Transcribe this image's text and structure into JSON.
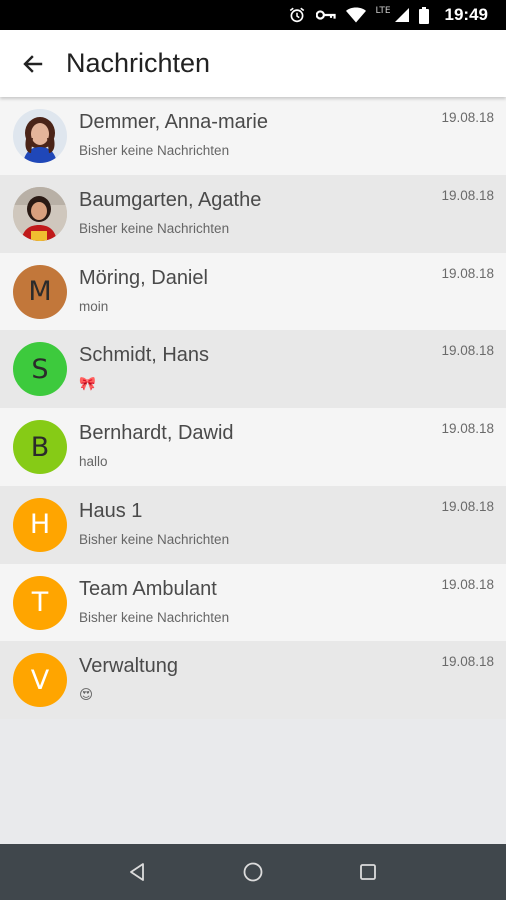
{
  "status_bar": {
    "network": "LTE",
    "time": "19:49",
    "icons": [
      "alarm-icon",
      "vpn-key-icon",
      "wifi-icon",
      "signal-icon",
      "battery-icon"
    ]
  },
  "app_bar": {
    "title": "Nachrichten",
    "back_icon": "arrow-left-icon"
  },
  "colors": {
    "status_bar": "#000000",
    "app_bar": "#ffffff",
    "row_light": "#f5f5f5",
    "row_dark": "#e8e8e8",
    "nav_bar": "#40474c",
    "avatar_brown": "#c2773a",
    "avatar_green": "#3dca3d",
    "avatar_lime": "#86cb16",
    "avatar_orange": "#ffa500"
  },
  "conversations": [
    {
      "name": "Demmer, Anna-marie",
      "preview": "Bisher keine Nachrichten",
      "date": "19.08.18",
      "avatar": "photo",
      "avatar_label": "",
      "avatar_color": ""
    },
    {
      "name": "Baumgarten, Agathe",
      "preview": "Bisher keine Nachrichten",
      "date": "19.08.18",
      "avatar": "photo",
      "avatar_label": "",
      "avatar_color": ""
    },
    {
      "name": "Möring, Daniel",
      "preview": "moin",
      "date": "19.08.18",
      "avatar": "letter",
      "avatar_label": "M",
      "avatar_color": "#c2773a"
    },
    {
      "name": "Schmidt, Hans",
      "preview": "🎀",
      "date": "19.08.18",
      "avatar": "letter",
      "avatar_label": "S",
      "avatar_color": "#3dca3d"
    },
    {
      "name": "Bernhardt, Dawid",
      "preview": "hallo",
      "date": "19.08.18",
      "avatar": "letter",
      "avatar_label": "B",
      "avatar_color": "#86cb16"
    },
    {
      "name": "Haus 1",
      "preview": "Bisher keine Nachrichten",
      "date": "19.08.18",
      "avatar": "letter",
      "avatar_label": "H",
      "avatar_color": "#ffa500"
    },
    {
      "name": "Team Ambulant",
      "preview": "Bisher keine Nachrichten",
      "date": "19.08.18",
      "avatar": "letter",
      "avatar_label": "T",
      "avatar_color": "#ffa500"
    },
    {
      "name": "Verwaltung",
      "preview": "😍",
      "date": "19.08.18",
      "avatar": "letter",
      "avatar_label": "V",
      "avatar_color": "#ffa500"
    }
  ],
  "nav_bar": {
    "icons": [
      "back-triangle-icon",
      "home-circle-icon",
      "recents-square-icon"
    ]
  }
}
